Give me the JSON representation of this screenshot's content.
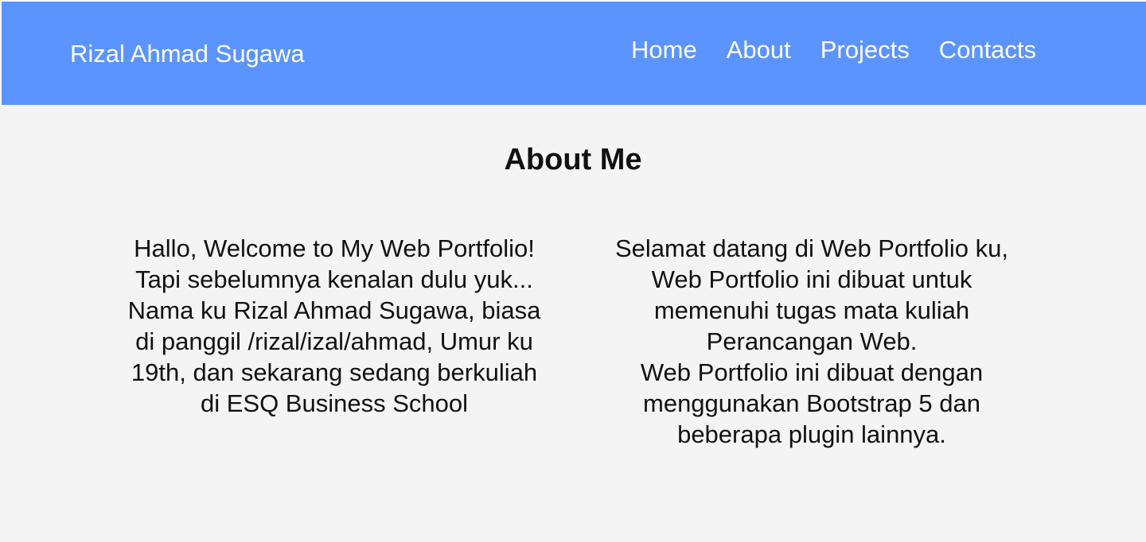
{
  "nav": {
    "brand": "Rizal Ahmad Sugawa",
    "links": [
      "Home",
      "About",
      "Projects",
      "Contacts"
    ]
  },
  "about": {
    "title": "About Me",
    "left_column": {
      "paragraph_1": "Hallo, Welcome to My Web Portfolio! Tapi sebelumnya kenalan dulu yuk...",
      "paragraph_2": "Nama ku Rizal Ahmad Sugawa, biasa di panggil /rizal/izal/ahmad, Umur ku 19th, dan sekarang sedang berkuliah di ESQ Business School"
    },
    "right_column": {
      "paragraph_1": "Selamat datang di Web Portfolio ku, Web Portfolio ini dibuat untuk memenuhi tugas mata kuliah Perancangan Web.",
      "paragraph_2": "Web Portfolio ini dibuat dengan menggunakan Bootstrap 5 dan beberapa plugin lainnya."
    }
  },
  "colors": {
    "navbar": "#5c94ff",
    "background": "#f4f4f4",
    "text": "#111111",
    "nav_text": "#ffffff"
  }
}
